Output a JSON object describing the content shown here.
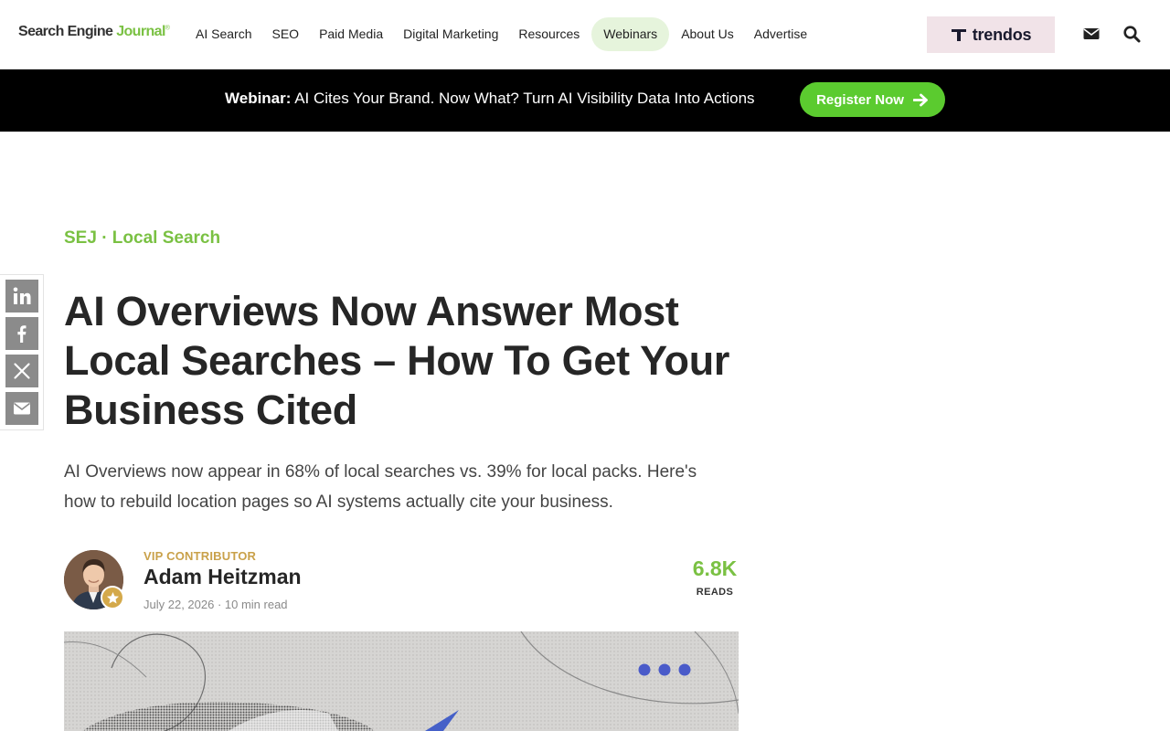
{
  "header": {
    "logo_main": "Search Engine ",
    "logo_accent": "Journal",
    "logo_tm": "®",
    "nav": [
      {
        "label": "AI Search",
        "active": false
      },
      {
        "label": "SEO",
        "active": false
      },
      {
        "label": "Paid Media",
        "active": false
      },
      {
        "label": "Digital Marketing",
        "active": false
      },
      {
        "label": "Resources",
        "active": false
      },
      {
        "label": "Webinars",
        "active": true
      },
      {
        "label": "About Us",
        "active": false
      },
      {
        "label": "Advertise",
        "active": false
      }
    ],
    "sponsor_name": "trendos",
    "icons": [
      "envelope-icon",
      "search-icon"
    ]
  },
  "webinar": {
    "label": "Webinar:",
    "text": " AI Cites Your Brand. Now What? Turn AI Visibility Data Into Actions",
    "button": "Register Now"
  },
  "article": {
    "category": "SEJ · Local Search",
    "title": "AI Overviews Now Answer Most Local Searches – How To Get Your Business Cited",
    "dek": "AI Overviews now appear in 68% of local searches vs. 39% for local packs. Here's how to rebuild location pages so AI systems actually cite your business.",
    "author": {
      "badge": "VIP CONTRIBUTOR",
      "name": "Adam Heitzman",
      "meta": "July 22, 2026 · 10 min read"
    },
    "reads": {
      "count": "6.8K",
      "label": "READS"
    }
  },
  "share": [
    "linkedin-icon",
    "facebook-icon",
    "x-icon",
    "email-icon"
  ],
  "colors": {
    "brand_green": "#7ac143",
    "button_green": "#5bcb2f",
    "active_nav_bg": "#e6f4dc",
    "vip_gold": "#c9a14a",
    "share_grey": "#8b8b8b",
    "sponsor_bg": "#f1e3e8"
  }
}
